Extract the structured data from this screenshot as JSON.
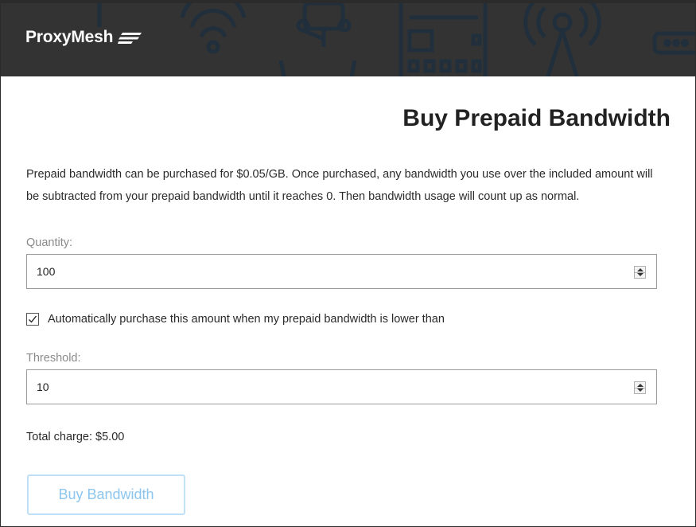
{
  "header": {
    "logo_text": "ProxyMesh"
  },
  "page": {
    "title": "Buy Prepaid Bandwidth",
    "description": "Prepaid bandwidth can be purchased for $0.05/GB. Once purchased, any bandwidth you use over the included amount will be subtracted from your prepaid bandwidth until it reaches 0. Then bandwidth usage will count up as normal."
  },
  "form": {
    "quantity_label": "Quantity:",
    "quantity_value": "100",
    "auto_purchase_checked": true,
    "auto_purchase_label": "Automatically purchase this amount when my prepaid bandwidth is lower than",
    "threshold_label": "Threshold:",
    "threshold_value": "10",
    "total_charge": "Total charge: $5.00",
    "buy_button_label": "Buy Bandwidth"
  },
  "colors": {
    "header_bg": "#333333",
    "button_border": "#bfe0f7",
    "button_text": "#8cc6ee"
  },
  "icons": [
    "logo-mark-icon",
    "wifi-icon",
    "router-icon",
    "phone-icon",
    "antenna-icon",
    "modem-icon",
    "checkmark-icon",
    "spinner-up-icon",
    "spinner-down-icon"
  ]
}
